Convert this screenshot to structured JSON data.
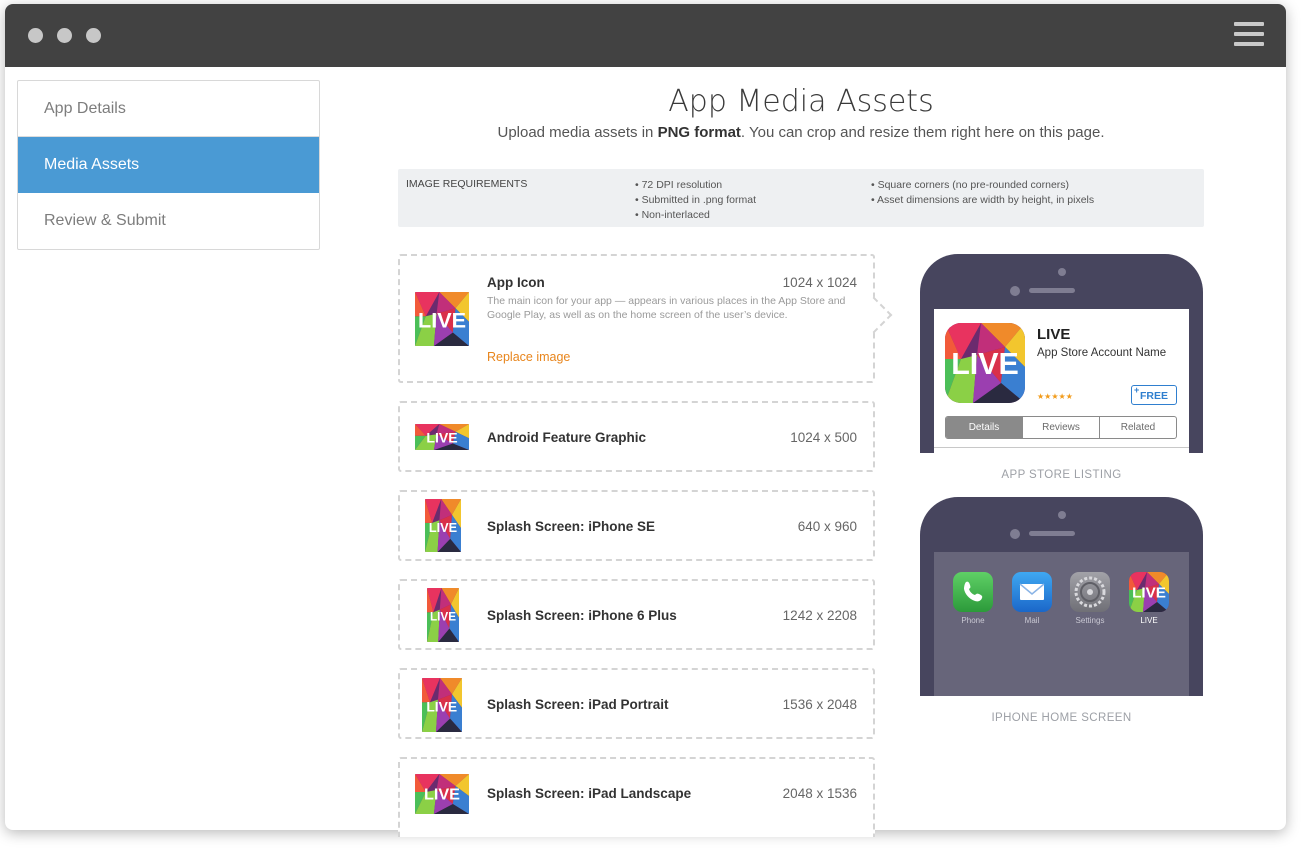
{
  "sidebar": {
    "items": [
      {
        "label": "App Details"
      },
      {
        "label": "Media Assets"
      },
      {
        "label": "Review & Submit"
      }
    ]
  },
  "header": {
    "title": "App Media Assets",
    "subtitle_pre": "Upload media assets in ",
    "subtitle_bold": "PNG format",
    "subtitle_post": ". You can crop and resize them right here on this page."
  },
  "requirements": {
    "heading": "IMAGE REQUIREMENTS",
    "col1": [
      "• 72 DPI resolution",
      "• Submitted in .png format",
      "• Non-interlaced"
    ],
    "col2": [
      "• Square corners (no pre-rounded corners)",
      "• Asset dimensions are width by height, in pixels"
    ]
  },
  "assets": [
    {
      "name": "App Icon",
      "dims": "1024 x 1024",
      "description": "The main icon for your app — appears in various places in the App Store and Google Play, as well as on the home screen of the user’s device.",
      "action": "Replace image"
    },
    {
      "name": "Android Feature Graphic",
      "dims": "1024 x 500"
    },
    {
      "name": "Splash Screen: iPhone SE",
      "dims": "640 x 960"
    },
    {
      "name": "Splash Screen: iPhone 6 Plus",
      "dims": "1242 x 2208"
    },
    {
      "name": "Splash Screen: iPad Portrait",
      "dims": "1536 x 2048"
    },
    {
      "name": "Splash Screen: iPad Landscape",
      "dims": "2048 x 1536"
    }
  ],
  "thumb_text": "LIVE",
  "store_preview": {
    "app_name": "LIVE",
    "account": "App Store Account Name",
    "stars": "★★★★★",
    "button": "FREE",
    "button_plus": "+",
    "tabs": [
      "Details",
      "Reviews",
      "Related"
    ],
    "active_tab": "Details",
    "caption": "APP STORE LISTING"
  },
  "home_preview": {
    "apps": [
      {
        "label": "Phone",
        "icon": "phone-icon"
      },
      {
        "label": "Mail",
        "icon": "mail-icon"
      },
      {
        "label": "Settings",
        "icon": "settings-icon"
      },
      {
        "label": "LIVE",
        "icon": "live-app-icon"
      }
    ],
    "caption": "IPHONE HOME SCREEN"
  },
  "colors": {
    "titlebar": "#424242",
    "active_nav": "#4a9ad4",
    "link_orange": "#e8851c",
    "phone_frame": "#47455e",
    "free_blue": "#2f7fcf"
  }
}
